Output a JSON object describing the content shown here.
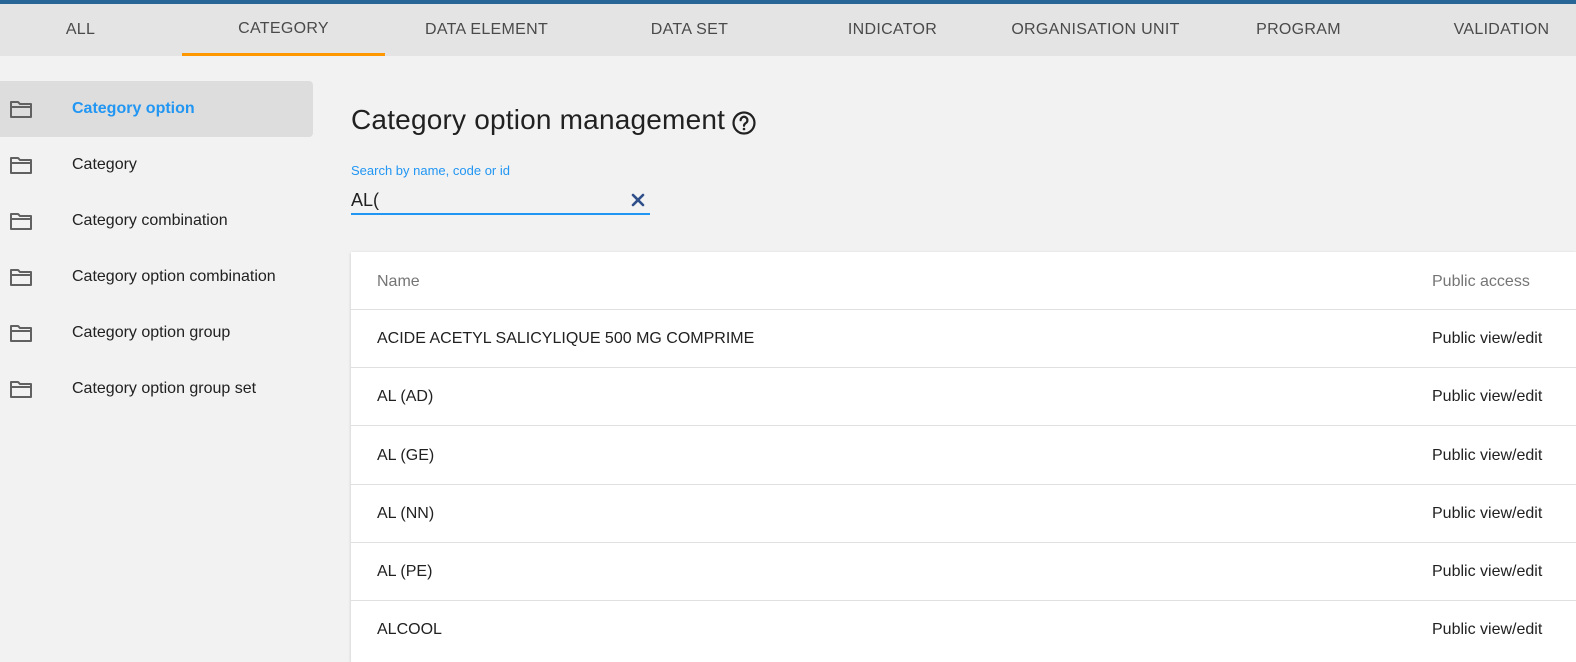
{
  "tabs": [
    {
      "label": "ALL",
      "active": false
    },
    {
      "label": "CATEGORY",
      "active": true
    },
    {
      "label": "DATA ELEMENT",
      "active": false
    },
    {
      "label": "DATA SET",
      "active": false
    },
    {
      "label": "INDICATOR",
      "active": false
    },
    {
      "label": "ORGANISATION UNIT",
      "active": false
    },
    {
      "label": "PROGRAM",
      "active": false
    },
    {
      "label": "VALIDATION",
      "active": false
    }
  ],
  "sidebar": {
    "items": [
      {
        "label": "Category option",
        "icon": "folder-icon",
        "active": true
      },
      {
        "label": "Category",
        "icon": "folder-icon",
        "active": false
      },
      {
        "label": "Category combination",
        "icon": "folder-icon",
        "active": false
      },
      {
        "label": "Category option combination",
        "icon": "folder-icon",
        "active": false
      },
      {
        "label": "Category option group",
        "icon": "folder-icon",
        "active": false
      },
      {
        "label": "Category option group set",
        "icon": "folder-icon",
        "active": false
      }
    ]
  },
  "main": {
    "title": "Category option management",
    "help_icon": "help-circle-icon",
    "search": {
      "label": "Search by name, code or id",
      "value": "AL("
    },
    "table": {
      "columns": [
        "Name",
        "Public access"
      ],
      "rows": [
        {
          "name": "ACIDE ACETYL SALICYLIQUE 500 MG COMPRIME",
          "public_access": "Public view/edit"
        },
        {
          "name": "AL (AD)",
          "public_access": "Public view/edit"
        },
        {
          "name": "AL (GE)",
          "public_access": "Public view/edit"
        },
        {
          "name": "AL (NN)",
          "public_access": "Public view/edit"
        },
        {
          "name": "AL (PE)",
          "public_access": "Public view/edit"
        },
        {
          "name": "ALCOOL",
          "public_access": "Public view/edit"
        }
      ]
    }
  },
  "colors": {
    "top_accent": "#276696",
    "active_tab_underline": "#ff9800",
    "link_blue": "#2196f3"
  }
}
